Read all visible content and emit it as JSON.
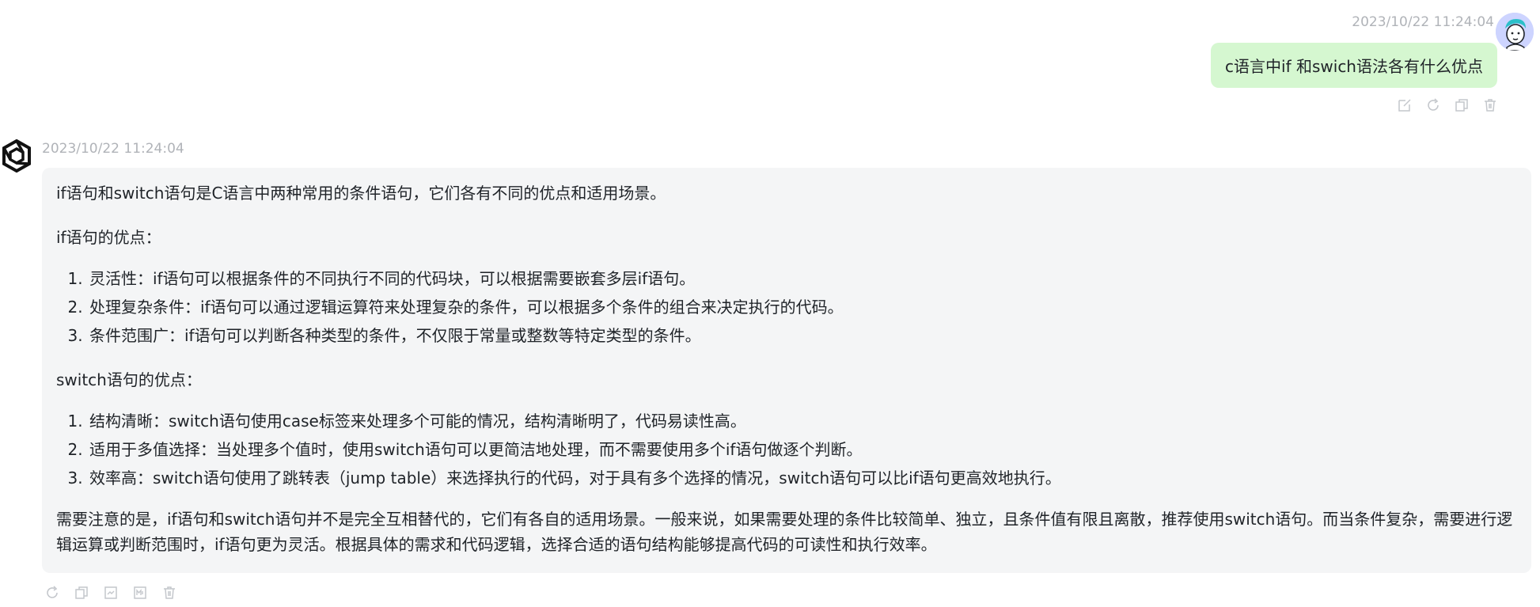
{
  "user_message": {
    "timestamp": "2023/10/22 11:24:04",
    "text": "c语言中if 和swich语法各有什么优点",
    "actions": [
      "edit-icon",
      "refresh-icon",
      "copy-icon",
      "delete-icon"
    ]
  },
  "bot_message": {
    "timestamp": "2023/10/22 11:24:04",
    "intro": "if语句和switch语句是C语言中两种常用的条件语句，它们各有不同的优点和适用场景。",
    "if_heading": "if语句的优点：",
    "if_points": [
      "灵活性：if语句可以根据条件的不同执行不同的代码块，可以根据需要嵌套多层if语句。",
      "处理复杂条件：if语句可以通过逻辑运算符来处理复杂的条件，可以根据多个条件的组合来决定执行的代码。",
      "条件范围广：if语句可以判断各种类型的条件，不仅限于常量或整数等特定类型的条件。"
    ],
    "switch_heading": "switch语句的优点：",
    "switch_points": [
      "结构清晰：switch语句使用case标签来处理多个可能的情况，结构清晰明了，代码易读性高。",
      "适用于多值选择：当处理多个值时，使用switch语句可以更简洁地处理，而不需要使用多个if语句做逐个判断。",
      "效率高：switch语句使用了跳转表（jump table）来选择执行的代码，对于具有多个选择的情况，switch语句可以比if语句更高效地执行。"
    ],
    "conclusion": "需要注意的是，if语句和switch语句并不是完全互相替代的，它们有各自的适用场景。一般来说，如果需要处理的条件比较简单、独立，且条件值有限且离散，推荐使用switch语句。而当条件复杂，需要进行逻辑运算或判断范围时，if语句更为灵活。根据具体的需求和代码逻辑，选择合适的语句结构能够提高代码的可读性和执行效率。",
    "actions": [
      "refresh-icon",
      "copy-icon",
      "save-image-icon",
      "markdown-icon",
      "delete-icon"
    ]
  },
  "colors": {
    "user_bubble": "#d5f7d0",
    "bot_bubble": "#f4f5f6",
    "timestamp": "#b0b3b8",
    "icon": "#c4c7cc"
  }
}
